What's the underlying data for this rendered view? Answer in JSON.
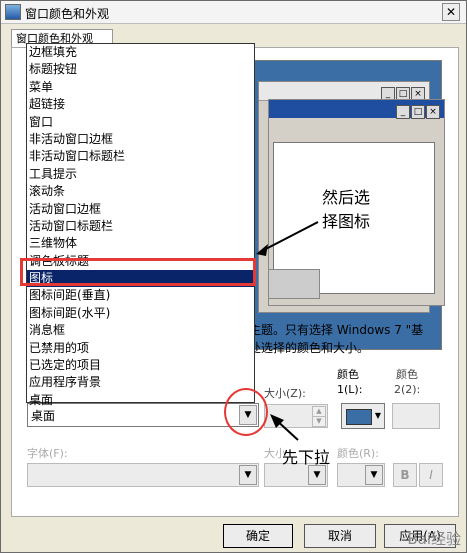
{
  "window": {
    "title": "窗口颜色和外观",
    "close_label": "✕"
  },
  "tab": {
    "label": "窗口颜色和外观"
  },
  "dropdown": {
    "items": [
      "边框填充",
      "标题按钮",
      "菜单",
      "超链接",
      "窗口",
      "非活动窗口边框",
      "非活动窗口标题栏",
      "工具提示",
      "滚动条",
      "活动窗口边框",
      "活动窗口标题栏",
      "三维物体",
      "调色板标题",
      "图标",
      "图标间距(垂直)",
      "图标间距(水平)",
      "消息框",
      "已禁用的项",
      "已选定的项目",
      "应用程序背景",
      "桌面"
    ],
    "selected": "图标"
  },
  "description": {
    "line1": "主题。只有选择 Windows 7 \"基",
    "line2": "处选择的颜色和大小。"
  },
  "item": {
    "selected_value": "桌面"
  },
  "labels": {
    "size": "大小(Z):",
    "color1": "颜色",
    "color1_sub": "1(L):",
    "color2": "颜色",
    "color2_sub": "2(2):",
    "font": "字体(F):",
    "font_size": "大小",
    "font_color": "颜色(R):"
  },
  "format": {
    "bold": "B",
    "italic": "I"
  },
  "buttons": {
    "ok": "确定",
    "cancel": "取消",
    "apply": "应用(A)"
  },
  "annotations": {
    "note_1a": "然后选",
    "note_1b": "择图标",
    "note_2": "先下拉"
  },
  "watermark": "Bai经验",
  "colors": {
    "selection": "#0a246a",
    "highlight_red": "#e53935",
    "desktop_blue": "#3a6ea5"
  }
}
